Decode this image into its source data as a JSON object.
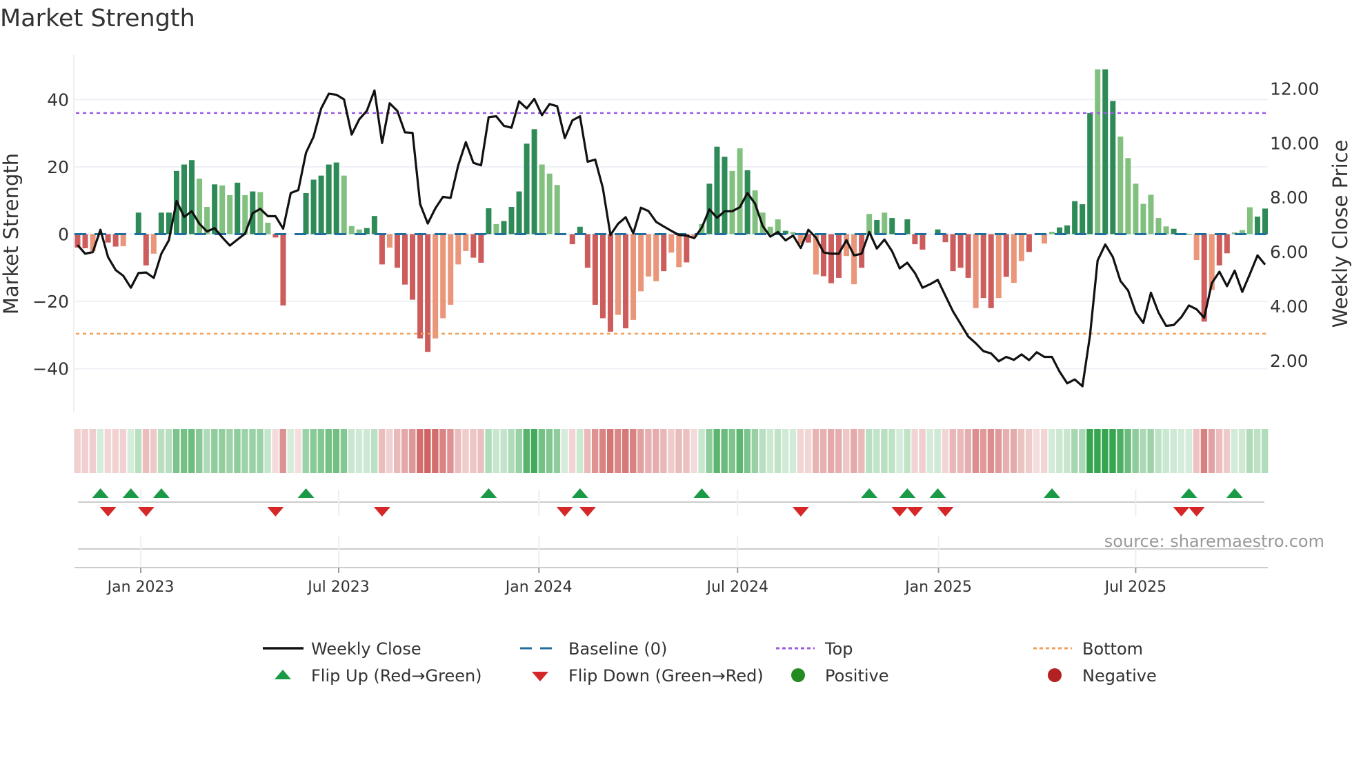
{
  "title": "Market Strength",
  "source": "source: sharemaestro.com",
  "colors": {
    "pos_strong": "#2e8b57",
    "pos_weak": "#82c07f",
    "neg_strong": "#cd5c5c",
    "neg_weak": "#e9967a",
    "price": "#111111",
    "baseline": "#1f6e9c",
    "top": "#9b59e0",
    "bottom": "#f2a05a",
    "flip_up": "#1a9a46",
    "flip_down": "#d62728",
    "positive": "#228b22",
    "negative": "#b22222"
  },
  "chart_data": {
    "type": "bar",
    "title": "Market Strength",
    "ylabel": "Market Strength",
    "y2label": "Weekly Close Price",
    "ylim": [
      -53,
      53
    ],
    "y2lim": [
      0.1,
      13.2
    ],
    "yticks": [
      "40",
      "20",
      "0",
      "−20",
      "−40"
    ],
    "ytick_values": [
      40,
      20,
      0,
      -20,
      -40
    ],
    "y2ticks": [
      "12.00",
      "10.00",
      "8.00",
      "6.00",
      "4.00",
      "2.00"
    ],
    "y2tick_values": [
      12,
      10,
      8,
      6,
      4,
      2
    ],
    "xticks": [
      "Jan 2023",
      "Jul 2023",
      "Jan 2024",
      "Jul 2024",
      "Jan 2025",
      "Jul 2025"
    ],
    "xtick_week_index": [
      9.3,
      35.3,
      61.6,
      87.7,
      114.1,
      140.0
    ],
    "top_level": 36,
    "bottom_level": -29.6,
    "baseline": 0,
    "strength": [
      -4,
      -4.2,
      -5,
      0,
      -2.5,
      -3.7,
      -3.6,
      0,
      6.4,
      -9.3,
      -5.8,
      6.4,
      6.4,
      18.8,
      20.7,
      22,
      16.5,
      8.1,
      14.8,
      14.5,
      11.6,
      15.3,
      11.6,
      12.7,
      12.5,
      3.4,
      -1,
      -21.2,
      0,
      -0.3,
      12.2,
      16.2,
      17.4,
      20.7,
      21.3,
      17.4,
      2.4,
      1.4,
      1.8,
      5.4,
      -9,
      -4,
      -10,
      -15,
      -19.5,
      -31,
      -35,
      -31,
      -25,
      -21,
      -9,
      -5,
      -7,
      -8.5,
      7.7,
      3,
      3.9,
      8.1,
      12.7,
      26.9,
      31.2,
      20.7,
      18,
      14.6,
      0,
      -3,
      2.2,
      -10,
      -21,
      -25,
      -29,
      -24,
      -28,
      -25.5,
      -17,
      -12.6,
      -14,
      -11,
      -5.5,
      -9.8,
      -8.4,
      -1,
      3,
      15,
      26,
      23,
      18.8,
      25.5,
      19,
      13,
      6.4,
      2.2,
      4.4,
      1,
      0.6,
      -3,
      -2.5,
      -12,
      -12.5,
      -14.6,
      -13,
      -6.5,
      -14.9,
      -10,
      6,
      4.2,
      6.4,
      4.8,
      0,
      4.4,
      -3,
      -4.6,
      0,
      1.4,
      -2.4,
      -11,
      -10,
      -13,
      -22,
      -19,
      -22,
      -19,
      -12.7,
      -14.5,
      -8,
      -5.3,
      -0.3,
      -2.8,
      0.7,
      2,
      2.6,
      9.8,
      8.9,
      36,
      49,
      49,
      39.6,
      29,
      22.6,
      15,
      9,
      11.7,
      4.8,
      2.3,
      1.6,
      0.1,
      0.1,
      -7.7,
      -26,
      -16.6,
      -9.3,
      -5.7,
      0.5,
      1.2,
      8,
      5.2,
      7.6
    ],
    "strength_shade": "ddldddlddd",
    "shade_codes": "ddldddldddldddddlldlldldlldddldddddllldddldddddllllldddldddddllldddddddldlllldlldlldddlldlllldlldldddlldldldldddddddddlddldlldllldddddlddllllllldllldlddlllddd ld",
    "weekly_close": [
      6.25,
      5.93,
      5.99,
      6.81,
      5.81,
      5.33,
      5.12,
      4.68,
      5.22,
      5.24,
      5.04,
      5.93,
      6.43,
      7.87,
      7.28,
      7.49,
      7.03,
      6.75,
      6.87,
      6.53,
      6.23,
      6.45,
      6.67,
      7.42,
      7.58,
      7.31,
      7.31,
      6.85,
      8.16,
      8.27,
      9.64,
      10.23,
      11.27,
      11.81,
      11.77,
      11.6,
      10.31,
      10.87,
      11.18,
      11.93,
      10.0,
      11.46,
      11.18,
      10.39,
      10.37,
      7.75,
      7.04,
      7.6,
      8.02,
      7.98,
      9.18,
      10.03,
      9.27,
      9.18,
      10.95,
      10.98,
      10.63,
      10.56,
      11.53,
      11.27,
      11.62,
      11.02,
      11.43,
      11.35,
      10.18,
      10.83,
      10.98,
      9.31,
      9.39,
      8.35,
      6.62,
      7.03,
      7.27,
      6.68,
      7.62,
      7.5,
      7.1,
      6.93,
      6.77,
      6.62,
      6.6,
      6.5,
      6.89,
      7.56,
      7.25,
      7.49,
      7.49,
      7.64,
      8.16,
      7.77,
      6.95,
      6.56,
      6.73,
      6.42,
      6.6,
      6.14,
      6.81,
      6.52,
      5.98,
      5.93,
      5.93,
      6.43,
      5.87,
      5.93,
      6.73,
      6.12,
      6.45,
      6.02,
      5.39,
      5.6,
      5.22,
      4.68,
      4.81,
      4.97,
      4.39,
      3.81,
      3.35,
      2.89,
      2.64,
      2.35,
      2.27,
      1.98,
      2.14,
      2.03,
      2.23,
      2.02,
      2.31,
      2.14,
      2.14,
      1.6,
      1.17,
      1.31,
      1.06,
      2.93,
      5.68,
      6.27,
      5.81,
      4.93,
      4.58,
      3.78,
      3.39,
      4.5,
      3.77,
      3.28,
      3.31,
      3.6,
      4.03,
      3.89,
      3.58,
      4.85,
      5.27,
      4.74,
      5.31,
      4.53,
      5.18,
      5.87,
      5.53
    ],
    "flip_up_weeks": [
      4,
      8,
      12,
      31,
      55,
      67,
      83,
      105,
      110,
      114,
      129,
      147,
      153
    ],
    "flip_down_weeks": [
      5,
      10,
      27,
      41,
      65,
      68,
      96,
      109,
      111,
      115,
      146,
      148
    ],
    "legend": {
      "placement": "bottom",
      "items": [
        "Weekly Close",
        "Baseline (0)",
        "Top",
        "Bottom",
        "Flip Up (Red→Green)",
        "Flip Down (Green→Red)",
        "Positive",
        "Negative"
      ]
    }
  }
}
